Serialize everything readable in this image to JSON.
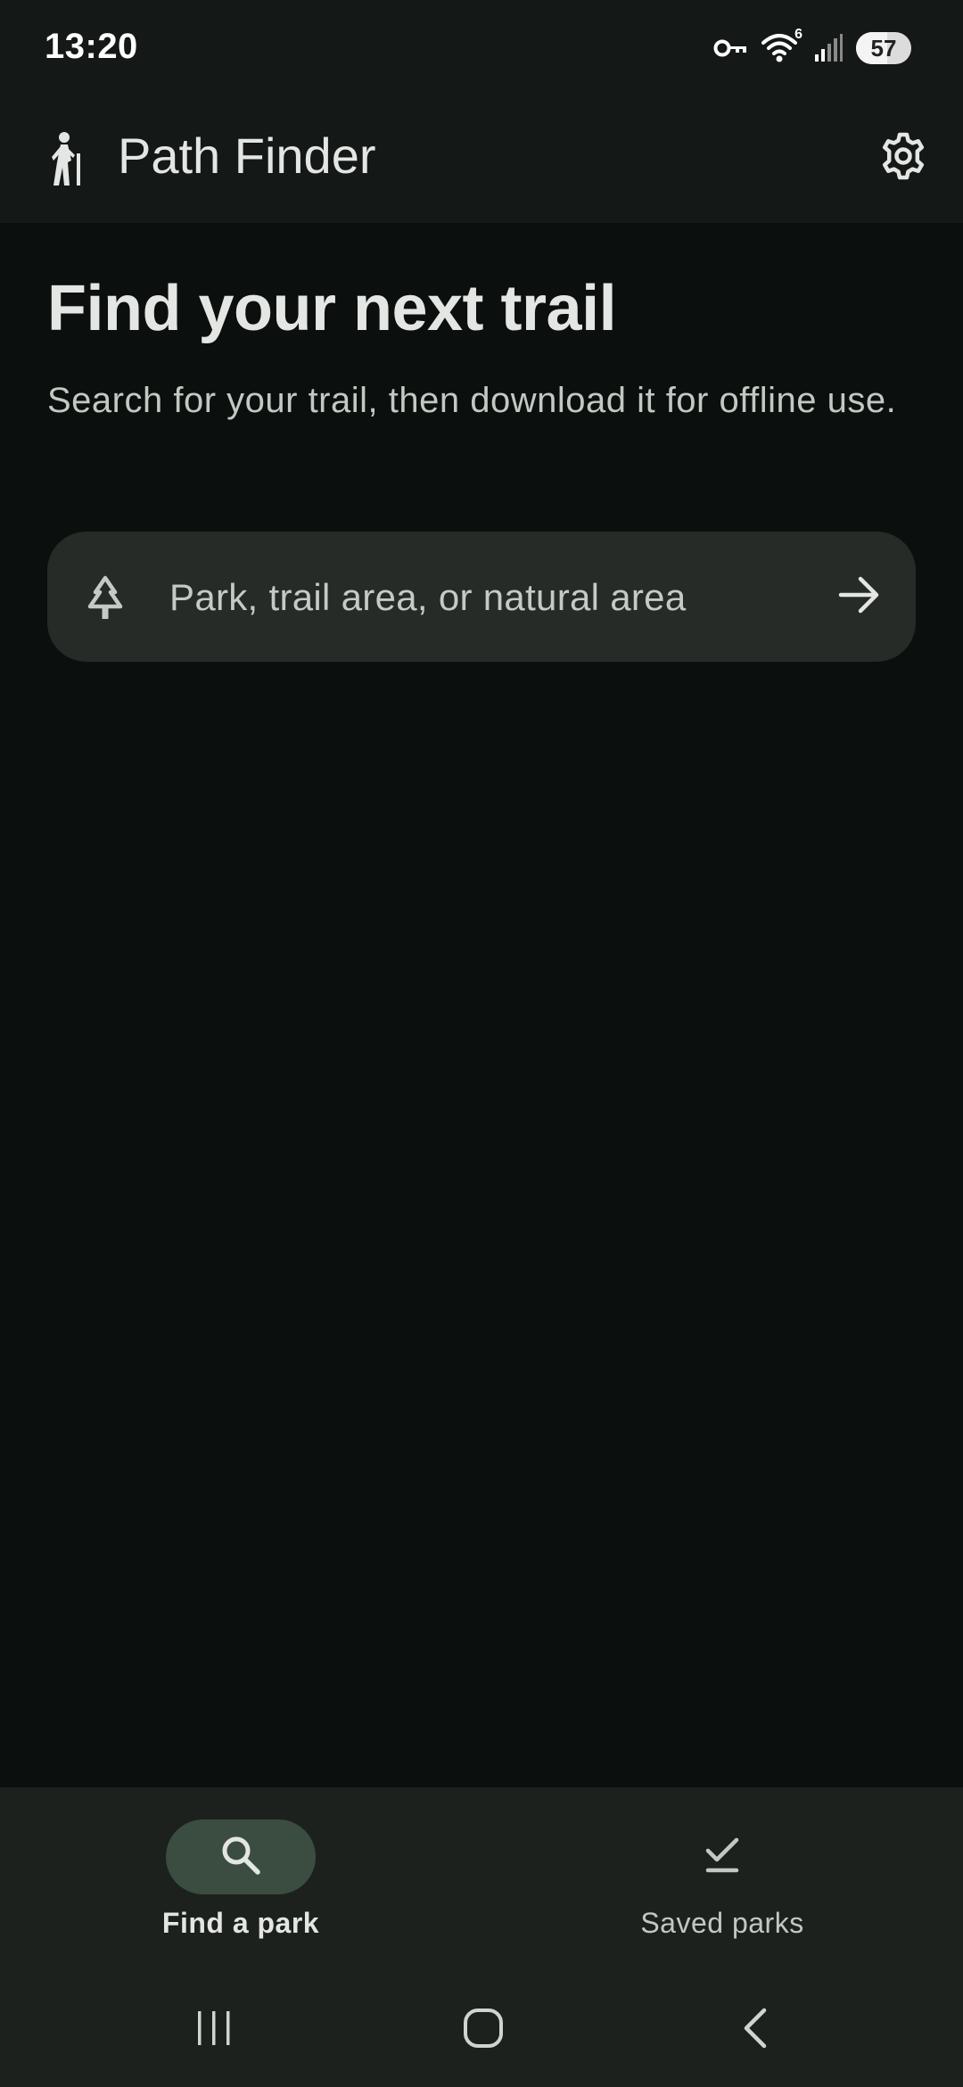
{
  "status_bar": {
    "time": "13:20",
    "wifi_badge": "6",
    "battery_level": "57",
    "icons": [
      "vpn-key-icon",
      "wifi-icon",
      "signal-icon",
      "battery-icon"
    ]
  },
  "app_bar": {
    "title": "Path Finder",
    "logo_icon": "hiker-icon",
    "settings_icon": "gear-icon"
  },
  "main": {
    "heading": "Find your next trail",
    "subheading": "Search for your trail, then download it for offline use.",
    "search": {
      "placeholder": "Park, trail area, or natural area",
      "leading_icon": "tree-icon",
      "trailing_icon": "arrow-right-icon"
    }
  },
  "bottom_nav": {
    "items": [
      {
        "label": "Find a park",
        "icon": "search-icon",
        "active": true
      },
      {
        "label": "Saved parks",
        "icon": "checkmark-icon",
        "active": false
      }
    ]
  },
  "system_nav": {
    "buttons": [
      "recents-icon",
      "home-icon",
      "back-icon"
    ]
  },
  "colors": {
    "background": "#0b0f0d",
    "surface": "#141816",
    "search_field": "#262b28",
    "nav_bar": "#1c211e",
    "active_pill": "#3a4d40",
    "text_primary": "#e3e6e2",
    "text_secondary": "#c2c8c2"
  }
}
